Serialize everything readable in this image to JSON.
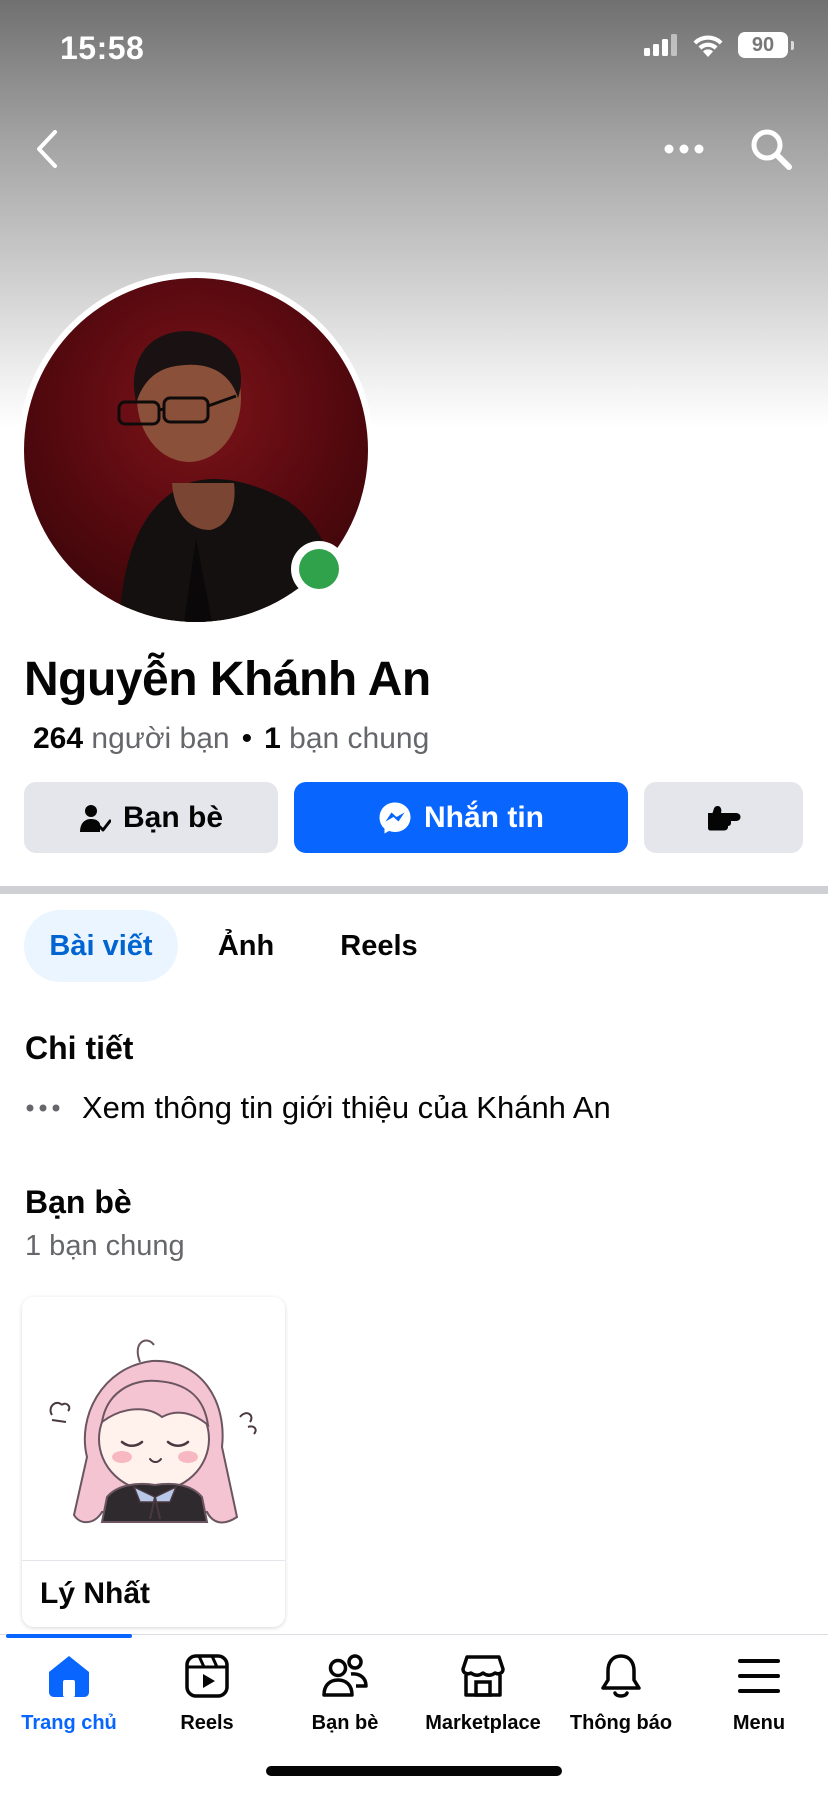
{
  "status_bar": {
    "time": "15:58",
    "battery": "90"
  },
  "profile": {
    "name": "Nguyễn Khánh An",
    "friends_count": "264",
    "friends_label": "người bạn",
    "mutual_count": "1",
    "mutual_label": "bạn chung"
  },
  "actions": {
    "friends_label": "Bạn bè",
    "message_label": "Nhắn tin"
  },
  "tabs": [
    {
      "label": "Bài viết"
    },
    {
      "label": "Ảnh"
    },
    {
      "label": "Reels"
    }
  ],
  "details": {
    "title": "Chi tiết",
    "about_text": "Xem thông tin giới thiệu của Khánh An"
  },
  "friends_section": {
    "title": "Bạn bè",
    "subtitle": "1 bạn chung",
    "cards": [
      {
        "name": "Lý Nhất"
      }
    ]
  },
  "bottom_nav": [
    {
      "label": "Trang chủ"
    },
    {
      "label": "Reels"
    },
    {
      "label": "Bạn bè"
    },
    {
      "label": "Marketplace"
    },
    {
      "label": "Thông báo"
    },
    {
      "label": "Menu"
    }
  ],
  "colors": {
    "accent": "#0866ff",
    "online": "#31a24c",
    "tab_active_bg": "#ebf5ff",
    "button_gray": "#e4e6eb"
  },
  "icons": [
    "back-icon",
    "more-icon",
    "search-icon",
    "friend-check-icon",
    "messenger-icon",
    "poke-icon",
    "more-dots-icon",
    "home-icon",
    "reels-icon",
    "friends-icon",
    "marketplace-icon",
    "bell-icon",
    "menu-icon"
  ]
}
